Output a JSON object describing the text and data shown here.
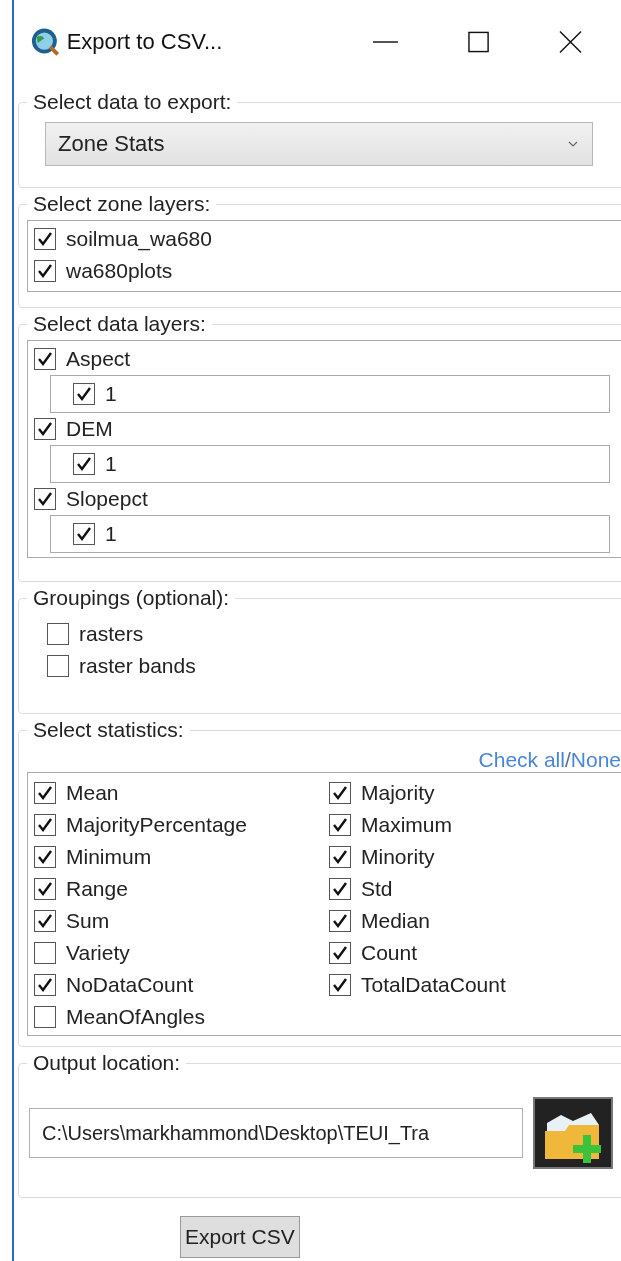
{
  "window": {
    "title": "Export to CSV..."
  },
  "data_export": {
    "label": "Select data to export:",
    "value": "Zone Stats"
  },
  "zone_layers": {
    "label": "Select zone layers:",
    "items": [
      {
        "label": "soilmua_wa680",
        "checked": true
      },
      {
        "label": "wa680plots",
        "checked": true
      }
    ]
  },
  "data_layers": {
    "label": "Select data layers:",
    "items": [
      {
        "label": "Aspect",
        "checked": true,
        "children": [
          {
            "label": "1",
            "checked": true
          }
        ]
      },
      {
        "label": "DEM",
        "checked": true,
        "children": [
          {
            "label": "1",
            "checked": true
          }
        ]
      },
      {
        "label": "Slopepct",
        "checked": true,
        "children": [
          {
            "label": "1",
            "checked": true
          }
        ]
      }
    ]
  },
  "groupings": {
    "label": "Groupings (optional):",
    "items": [
      {
        "label": "rasters",
        "checked": false
      },
      {
        "label": "raster bands",
        "checked": false
      }
    ]
  },
  "statistics": {
    "label": "Select statistics:",
    "check_all": "Check all",
    "separator": "/",
    "none": "None",
    "items": [
      {
        "label": "Mean",
        "checked": true
      },
      {
        "label": "Majority",
        "checked": true
      },
      {
        "label": "MajorityPercentage",
        "checked": true
      },
      {
        "label": "Maximum",
        "checked": true
      },
      {
        "label": "Minimum",
        "checked": true
      },
      {
        "label": "Minority",
        "checked": true
      },
      {
        "label": "Range",
        "checked": true
      },
      {
        "label": "Std",
        "checked": true
      },
      {
        "label": "Sum",
        "checked": true
      },
      {
        "label": "Median",
        "checked": true
      },
      {
        "label": "Variety",
        "checked": false
      },
      {
        "label": "Count",
        "checked": true
      },
      {
        "label": "NoDataCount",
        "checked": true
      },
      {
        "label": "TotalDataCount",
        "checked": true
      },
      {
        "label": "MeanOfAngles",
        "checked": false
      }
    ]
  },
  "output": {
    "label": "Output location:",
    "value": "C:\\Users\\markhammond\\Desktop\\TEUI_Tra"
  },
  "export_button": "Export CSV"
}
